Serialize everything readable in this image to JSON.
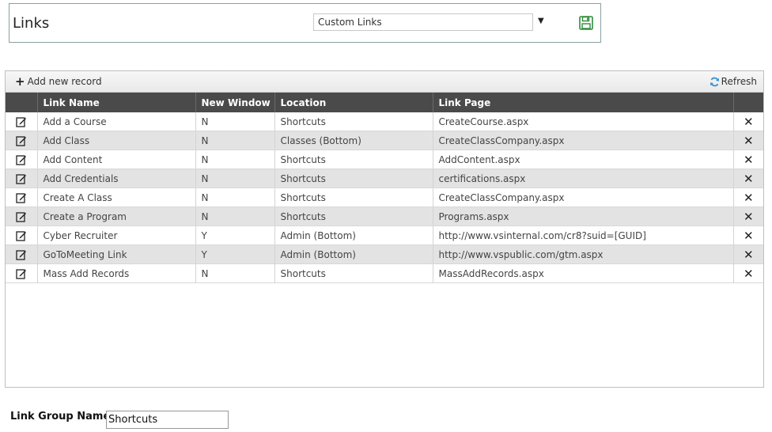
{
  "header": {
    "title": "Links",
    "group_select_value": "Custom Links",
    "save_icon": "save-icon"
  },
  "toolbar": {
    "add_label": "Add new record",
    "refresh_label": "Refresh"
  },
  "grid": {
    "columns": [
      "",
      "Link Name",
      "New Window",
      "Location",
      "Link Page",
      ""
    ],
    "rows": [
      {
        "name": "Add a Course",
        "new_window": "N",
        "location": "Shortcuts",
        "page": "CreateCourse.aspx"
      },
      {
        "name": "Add Class",
        "new_window": "N",
        "location": "Classes (Bottom)",
        "page": "CreateClassCompany.aspx"
      },
      {
        "name": "Add Content",
        "new_window": "N",
        "location": "Shortcuts",
        "page": "AddContent.aspx"
      },
      {
        "name": "Add Credentials",
        "new_window": "N",
        "location": "Shortcuts",
        "page": "certifications.aspx"
      },
      {
        "name": "Create A Class",
        "new_window": "N",
        "location": "Shortcuts",
        "page": "CreateClassCompany.aspx"
      },
      {
        "name": "Create a Program",
        "new_window": "N",
        "location": "Shortcuts",
        "page": "Programs.aspx"
      },
      {
        "name": "Cyber Recruiter",
        "new_window": "Y",
        "location": "Admin (Bottom)",
        "page": "http://www.vsinternal.com/cr8?suid=[GUID]"
      },
      {
        "name": "GoToMeeting Link",
        "new_window": "Y",
        "location": "Admin (Bottom)",
        "page": "http://www.vspublic.com/gtm.aspx"
      },
      {
        "name": "Mass Add Records",
        "new_window": "N",
        "location": "Shortcuts",
        "page": "MassAddRecords.aspx"
      }
    ]
  },
  "footer": {
    "group_name_label": "Link Group Name",
    "group_name_value": "Shortcuts"
  },
  "colors": {
    "header_bg": "#4a4a4a",
    "alt_row": "#e3e3e3",
    "save_icon": "#2e8b3a",
    "refresh_icon": "#3a8fd0"
  }
}
